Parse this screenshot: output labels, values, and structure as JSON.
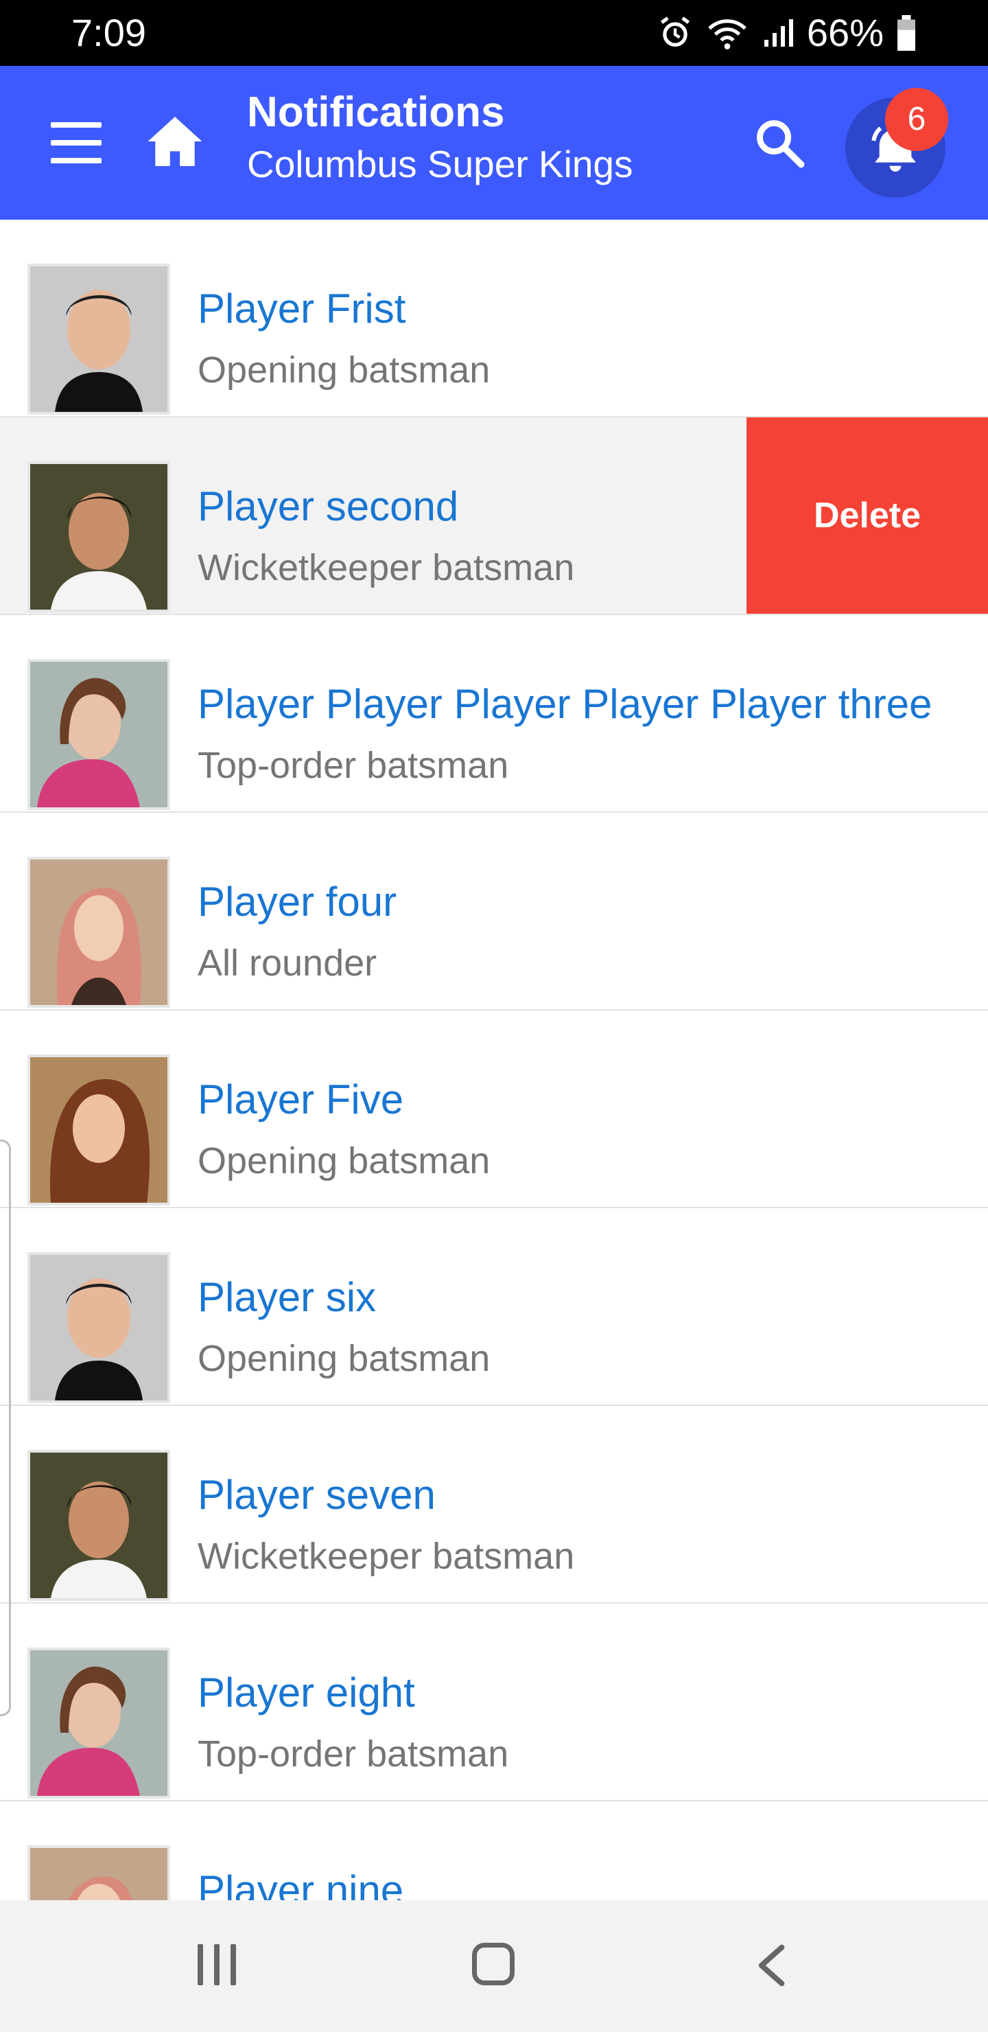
{
  "status_bar": {
    "time": "7:09",
    "battery_percent": "66%",
    "icons": [
      "alarm-icon",
      "wifi-icon",
      "signal-icon",
      "battery-icon"
    ]
  },
  "app_bar": {
    "title": "Notifications",
    "subtitle": "Columbus Super Kings",
    "notification_count": "6",
    "color": "#3d5afe",
    "icons": [
      "menu-icon",
      "home-icon",
      "search-icon",
      "bell-icon"
    ]
  },
  "players": [
    {
      "name": "Player Frist",
      "role": "Opening batsman"
    },
    {
      "name": "Player second",
      "role": "Wicketkeeper batsman",
      "action": "Delete"
    },
    {
      "name": "Player Player Player Player Player three",
      "role": "Top-order batsman"
    },
    {
      "name": "Player four",
      "role": "All rounder"
    },
    {
      "name": "Player Five",
      "role": "Opening batsman"
    },
    {
      "name": "Player six",
      "role": "Opening batsman"
    },
    {
      "name": "Player seven",
      "role": "Wicketkeeper batsman"
    },
    {
      "name": "Player eight",
      "role": "Top-order batsman"
    },
    {
      "name": "Player nine",
      "role": ""
    }
  ],
  "colors": {
    "name_text": "#1976d2",
    "role_text": "#757575",
    "delete": "#f44336"
  },
  "nav_bar": {
    "icons": [
      "recents-icon",
      "home-circle-icon",
      "back-icon"
    ]
  }
}
